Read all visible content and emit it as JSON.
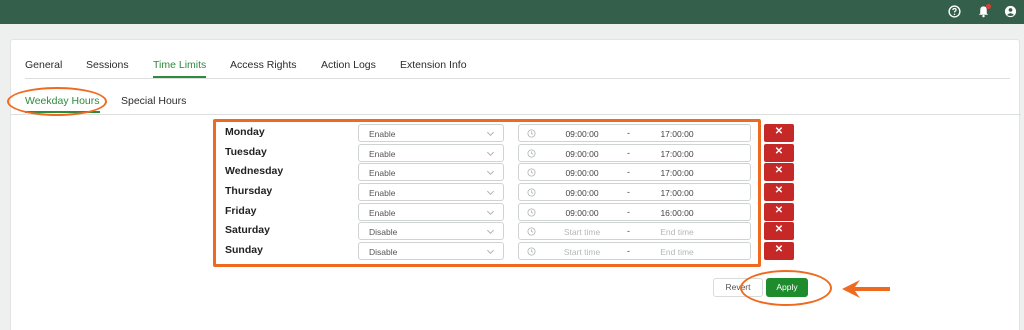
{
  "header": {
    "icons": [
      "help-circle-icon",
      "bell-icon",
      "user-account-icon"
    ],
    "notification_color": "#e53935"
  },
  "tabs": [
    {
      "label": "General",
      "active": false
    },
    {
      "label": "Sessions",
      "active": false
    },
    {
      "label": "Time Limits",
      "active": true
    },
    {
      "label": "Access Rights",
      "active": false
    },
    {
      "label": "Action Logs",
      "active": false
    },
    {
      "label": "Extension Info",
      "active": false
    }
  ],
  "subtabs": [
    {
      "label": "Weekday Hours",
      "active": true
    },
    {
      "label": "Special Hours",
      "active": false
    }
  ],
  "schedule": [
    {
      "day": "Monday",
      "status": "Enable",
      "start": "09:00:00",
      "separator": "-",
      "end": "17:00:00"
    },
    {
      "day": "Tuesday",
      "status": "Enable",
      "start": "09:00:00",
      "separator": "-",
      "end": "17:00:00"
    },
    {
      "day": "Wednesday",
      "status": "Enable",
      "start": "09:00:00",
      "separator": "-",
      "end": "17:00:00"
    },
    {
      "day": "Thursday",
      "status": "Enable",
      "start": "09:00:00",
      "separator": "-",
      "end": "17:00:00"
    },
    {
      "day": "Friday",
      "status": "Enable",
      "start": "09:00:00",
      "separator": "-",
      "end": "16:00:00"
    },
    {
      "day": "Saturday",
      "status": "Disable",
      "start": "Start time",
      "separator": "-",
      "end": "End time"
    },
    {
      "day": "Sunday",
      "status": "Disable",
      "start": "Start time",
      "separator": "-",
      "end": "End time"
    }
  ],
  "delete_label": "✕",
  "actions": {
    "revert_label": "Revert",
    "apply_label": "Apply"
  },
  "colors": {
    "topbar": "#34604b",
    "accent_green": "#2e8b3e",
    "apply_button": "#1e8b2d",
    "delete_button": "#c62828",
    "annotation_orange": "#ef6a1f"
  }
}
